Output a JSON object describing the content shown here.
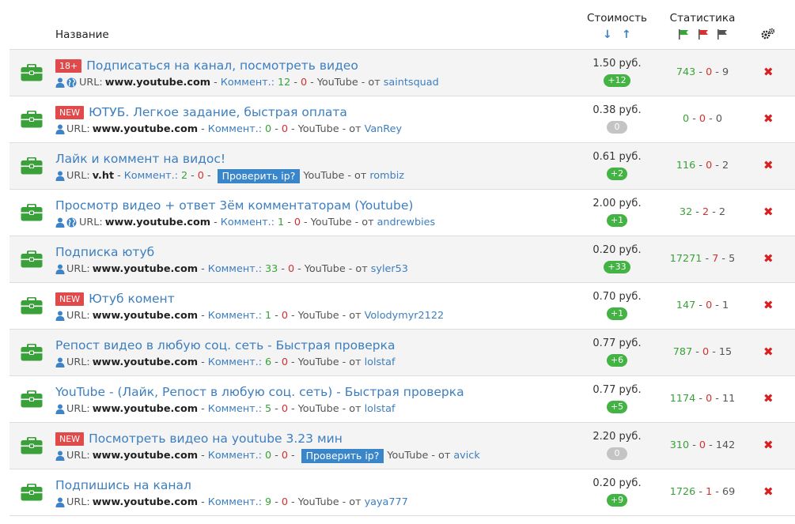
{
  "header": {
    "name_label": "Название",
    "cost_label": "Стоимость",
    "stats_label": "Статистика",
    "sort_down_icon": "arrow-down-icon",
    "sort_up_icon": "arrow-up-icon"
  },
  "colors": {
    "link": "#3d7ebf",
    "green": "#3aa13a",
    "red": "#d63030",
    "badge": "#e04a4a",
    "ip_button": "#3a86cb",
    "briefcase": "#3aa13a"
  },
  "tasks": [
    {
      "badge": "18+",
      "title": "Подписаться на канал, посмотреть видео",
      "globe": true,
      "url_label": "URL:",
      "url": "www.youtube.com",
      "comm_label": "Коммент.:",
      "comm_good": "12",
      "comm_bad": "0",
      "ip_button": "",
      "source": "YouTube",
      "from_label": "от",
      "author": "saintsquad",
      "price": "1.50 руб.",
      "pill": "+12",
      "pill_color": "green",
      "stat_good": "743",
      "stat_bad": "0",
      "stat_other": "9"
    },
    {
      "badge": "NEW",
      "title": "ЮТУБ. Легкое задание, быстрая оплата",
      "globe": false,
      "url_label": "URL:",
      "url": "www.youtube.com",
      "comm_label": "Коммент.:",
      "comm_good": "0",
      "comm_bad": "0",
      "ip_button": "",
      "source": "YouTube",
      "from_label": "от",
      "author": "VanRey",
      "price": "0.38 руб.",
      "pill": "0",
      "pill_color": "gray",
      "stat_good": "0",
      "stat_bad": "0",
      "stat_other": "0"
    },
    {
      "badge": "",
      "title": "Лайк и коммент на видос!",
      "globe": false,
      "url_label": "URL:",
      "url": "v.ht",
      "comm_label": "Коммент.:",
      "comm_good": "2",
      "comm_bad": "0",
      "ip_button": "Проверить ip?",
      "source": "YouTube",
      "from_label": "от",
      "author": "rombiz",
      "price": "0.61 руб.",
      "pill": "+2",
      "pill_color": "green",
      "stat_good": "116",
      "stat_bad": "0",
      "stat_other": "2"
    },
    {
      "badge": "",
      "title": "Просмотр видео + ответ 3ём комментаторам (Youtube)",
      "globe": true,
      "url_label": "URL:",
      "url": "www.youtube.com",
      "comm_label": "Коммент.:",
      "comm_good": "1",
      "comm_bad": "0",
      "ip_button": "",
      "source": "YouTube",
      "from_label": "от",
      "author": "andrewbies",
      "price": "2.00 руб.",
      "pill": "+1",
      "pill_color": "green",
      "stat_good": "32",
      "stat_bad": "2",
      "stat_other": "2"
    },
    {
      "badge": "",
      "title": "Подписка ютуб",
      "globe": false,
      "url_label": "URL:",
      "url": "www.youtube.com",
      "comm_label": "Коммент.:",
      "comm_good": "33",
      "comm_bad": "0",
      "ip_button": "",
      "source": "YouTube",
      "from_label": "от",
      "author": "syler53",
      "price": "0.20 руб.",
      "pill": "+33",
      "pill_color": "green",
      "stat_good": "17271",
      "stat_bad": "7",
      "stat_other": "5"
    },
    {
      "badge": "NEW",
      "title": "Ютуб комент",
      "globe": false,
      "url_label": "URL:",
      "url": "www.youtube.com",
      "comm_label": "Коммент.:",
      "comm_good": "1",
      "comm_bad": "0",
      "ip_button": "",
      "source": "YouTube",
      "from_label": "от",
      "author": "Volodymyr2122",
      "price": "0.70 руб.",
      "pill": "+1",
      "pill_color": "green",
      "stat_good": "147",
      "stat_bad": "0",
      "stat_other": "1"
    },
    {
      "badge": "",
      "title": "Репост видео в любую соц. сеть - Быстрая проверка",
      "globe": false,
      "url_label": "URL:",
      "url": "www.youtube.com",
      "comm_label": "Коммент.:",
      "comm_good": "6",
      "comm_bad": "0",
      "ip_button": "",
      "source": "YouTube",
      "from_label": "от",
      "author": "lolstaf",
      "price": "0.77 руб.",
      "pill": "+6",
      "pill_color": "green",
      "stat_good": "787",
      "stat_bad": "0",
      "stat_other": "15"
    },
    {
      "badge": "",
      "title": "YouTube - (Лайк, Репост в любую соц. сеть) - Быстрая проверка",
      "globe": false,
      "url_label": "URL:",
      "url": "www.youtube.com",
      "comm_label": "Коммент.:",
      "comm_good": "5",
      "comm_bad": "0",
      "ip_button": "",
      "source": "YouTube",
      "from_label": "от",
      "author": "lolstaf",
      "price": "0.77 руб.",
      "pill": "+5",
      "pill_color": "green",
      "stat_good": "1174",
      "stat_bad": "0",
      "stat_other": "11"
    },
    {
      "badge": "NEW",
      "title": "Посмотреть видео на youtube 3.23 мин",
      "globe": false,
      "url_label": "URL:",
      "url": "www.youtube.com",
      "comm_label": "Коммент.:",
      "comm_good": "0",
      "comm_bad": "0",
      "ip_button": "Проверить ip?",
      "source": "YouTube",
      "from_label": "от",
      "author": "avick",
      "price": "2.20 руб.",
      "pill": "0",
      "pill_color": "gray",
      "stat_good": "310",
      "stat_bad": "0",
      "stat_other": "142"
    },
    {
      "badge": "",
      "title": "Подпишись на канал",
      "globe": false,
      "url_label": "URL:",
      "url": "www.youtube.com",
      "comm_label": "Коммент.:",
      "comm_good": "9",
      "comm_bad": "0",
      "ip_button": "",
      "source": "YouTube",
      "from_label": "от",
      "author": "yaya777",
      "price": "0.20 руб.",
      "pill": "+9",
      "pill_color": "green",
      "stat_good": "1726",
      "stat_bad": "1",
      "stat_other": "69"
    }
  ]
}
